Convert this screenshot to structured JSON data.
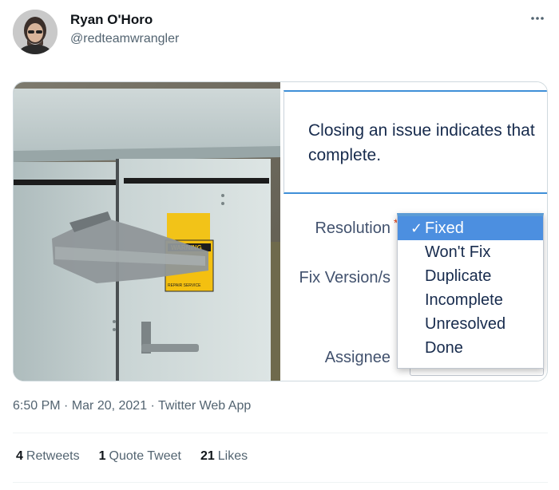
{
  "author": {
    "display_name": "Ryan O'Horo",
    "handle": "@redteamwrangler"
  },
  "icons": {
    "more": "more-horizontal-icon"
  },
  "media": {
    "photo": {
      "warning_text": "WARNING",
      "service_text": "REPAIR SERVICE"
    },
    "screenshot": {
      "message": "Closing an issue indicates that complete.",
      "labels": {
        "resolution": "Resolution",
        "fix_version": "Fix Version/s",
        "assignee": "Assignee"
      },
      "required_mark": "*",
      "options": [
        {
          "label": "Fixed",
          "selected": true
        },
        {
          "label": "Won't Fix",
          "selected": false
        },
        {
          "label": "Duplicate",
          "selected": false
        },
        {
          "label": "Incomplete",
          "selected": false
        },
        {
          "label": "Unresolved",
          "selected": false
        },
        {
          "label": "Done",
          "selected": false
        }
      ],
      "check_glyph": "✓"
    }
  },
  "meta": {
    "time": "6:50 PM",
    "separator": " · ",
    "date": "Mar 20, 2021",
    "source": "Twitter Web App"
  },
  "stats": {
    "retweets": {
      "count": "4",
      "label": "Retweets"
    },
    "quotes": {
      "count": "1",
      "label": "Quote Tweet"
    },
    "likes": {
      "count": "21",
      "label": "Likes"
    }
  },
  "colors": {
    "accent": "#1d9bf0",
    "secondary_text": "#536471",
    "selection": "#4c8fe0"
  }
}
